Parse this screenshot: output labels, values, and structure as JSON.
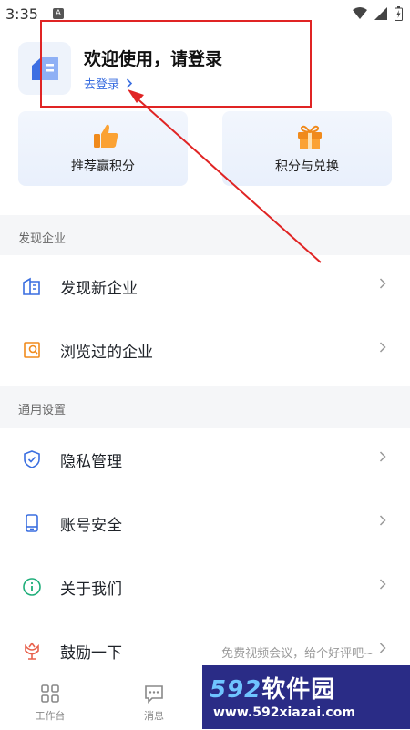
{
  "status_bar": {
    "time": "3:35",
    "notif_letter": "A"
  },
  "header": {
    "welcome": "欢迎使用，请登录",
    "login_link": "去登录"
  },
  "promo": [
    {
      "label": "推荐赢积分",
      "icon": "thumbs-up-icon"
    },
    {
      "label": "积分与兑换",
      "icon": "gift-icon"
    }
  ],
  "sections": [
    {
      "title": "发现企业",
      "items": [
        {
          "label": "发现新企业",
          "icon": "building-icon"
        },
        {
          "label": "浏览过的企业",
          "icon": "history-icon"
        }
      ]
    },
    {
      "title": "通用设置",
      "items": [
        {
          "label": "隐私管理",
          "icon": "shield-icon"
        },
        {
          "label": "账号安全",
          "icon": "phone-icon"
        },
        {
          "label": "关于我们",
          "icon": "info-icon"
        },
        {
          "label": "鼓励一下",
          "icon": "flower-icon",
          "hint": "免费视频会议，给个好评吧~"
        }
      ]
    }
  ],
  "tabbar": [
    {
      "label": "工作台",
      "icon": "grid-icon"
    },
    {
      "label": "消息",
      "icon": "chat-icon"
    }
  ],
  "watermark": {
    "brand_num": "592",
    "brand_text": "软件园",
    "url": "www.592xiazai.com"
  },
  "colors": {
    "accent": "#3a6ee0",
    "annotation": "#e02424",
    "section_bg": "#f5f6f8"
  }
}
